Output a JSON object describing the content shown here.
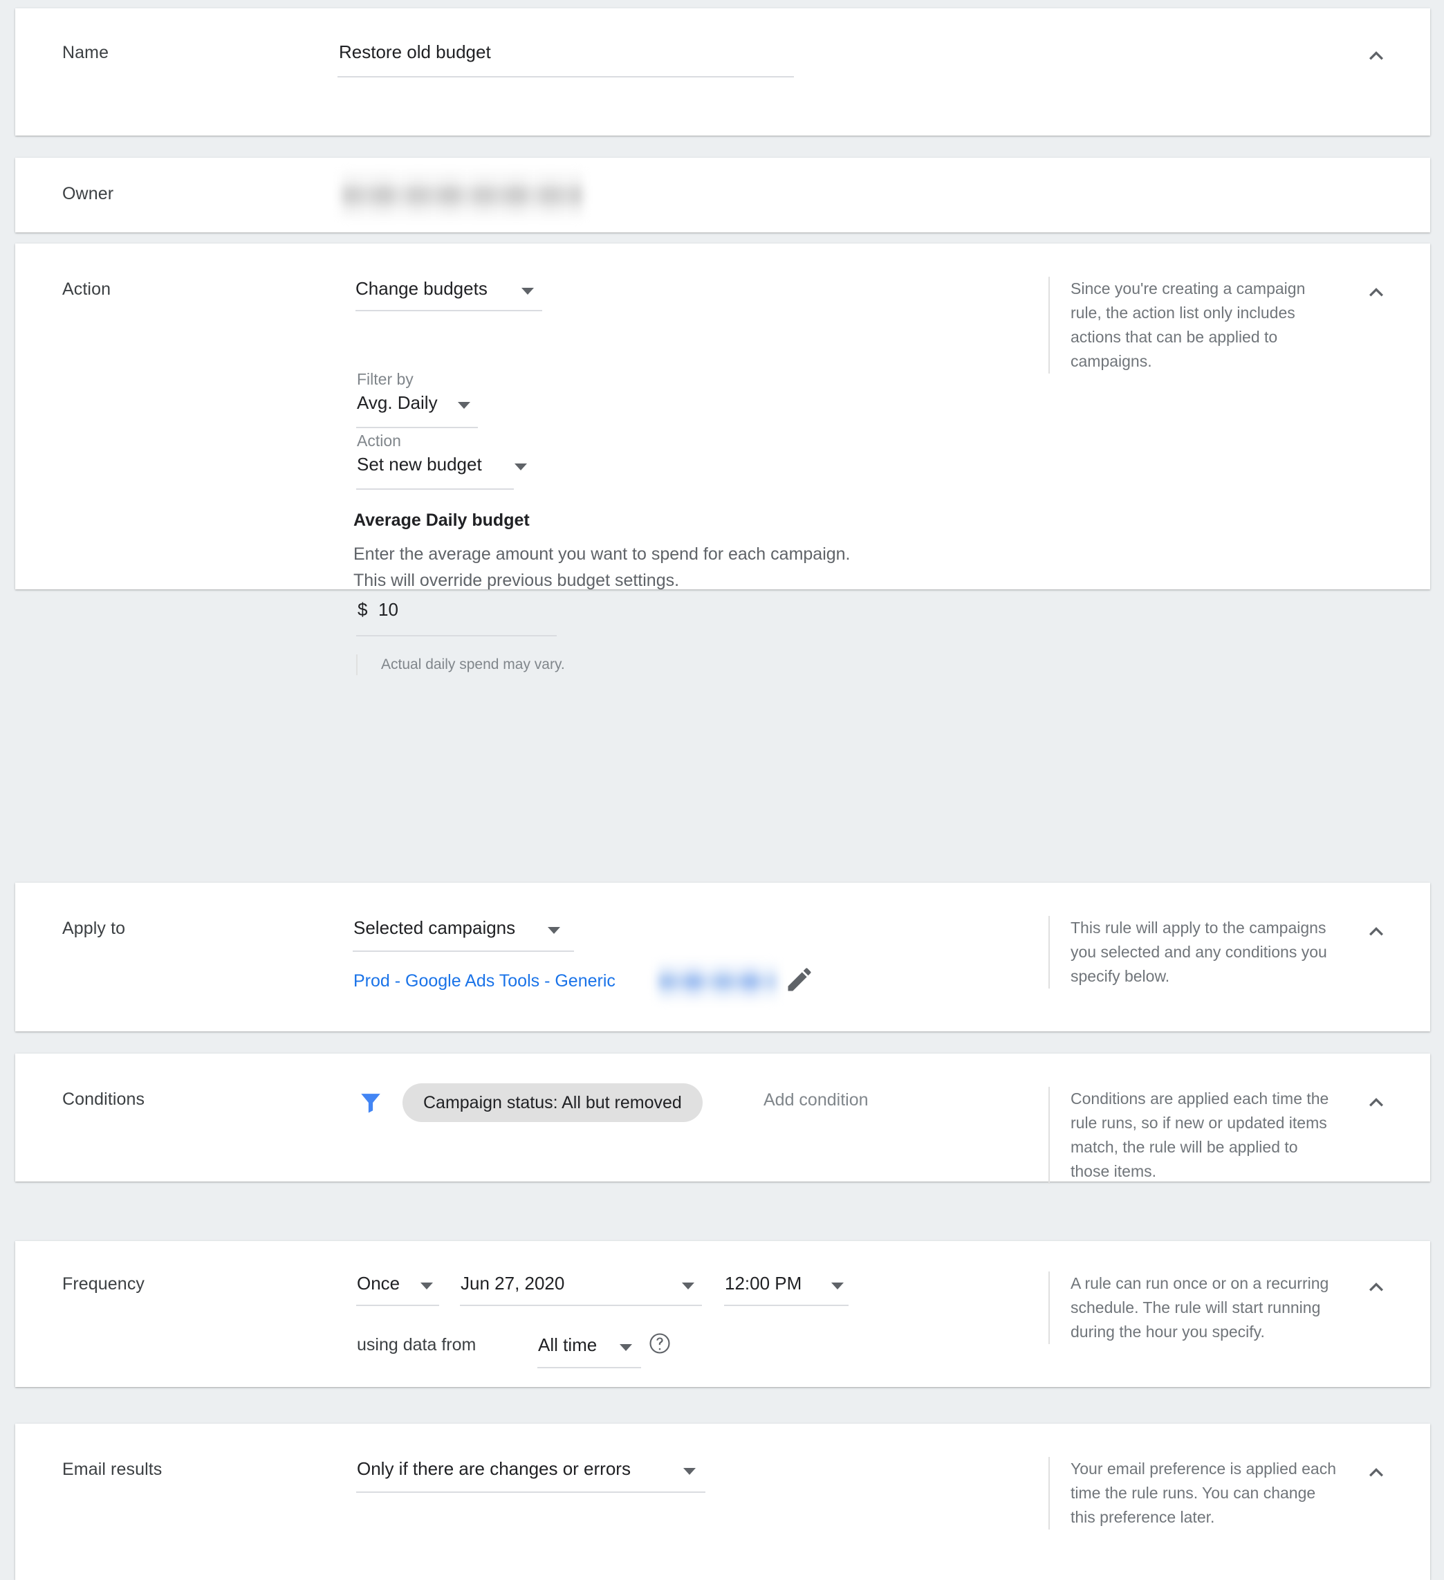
{
  "theme": {
    "page_background": "#eceff1",
    "card_background": "#ffffff",
    "text_primary": "#202124",
    "text_secondary": "#5f6368",
    "text_muted": "#80868b",
    "link_blue": "#1a73e8",
    "filter_icon_blue": "#4285f4",
    "chip_background": "#e0e0e0",
    "divider": "#dadce0"
  },
  "sections": {
    "name": {
      "label": "Name",
      "value": "Restore old budget",
      "collapse_icon": "chevron-up-icon"
    },
    "owner": {
      "label": "Owner",
      "value_redacted": true,
      "collapse_icon": null
    },
    "action": {
      "label": "Action",
      "action_select": "Change budgets",
      "filter_by_label": "Filter by",
      "filter_by_select": "Avg. Daily",
      "inner_action_label": "Action",
      "inner_action_select": "Set new budget",
      "budget_heading": "Average Daily budget",
      "budget_desc_line1": "Enter the average amount you want to spend for each campaign.",
      "budget_desc_line2": "This will override previous budget settings.",
      "currency_symbol": "$",
      "budget_amount": "10",
      "footnote": "Actual daily spend may vary.",
      "help": "Since you're creating a campaign rule, the action list only includes actions that can be applied to campaigns.",
      "collapse_icon": "chevron-up-icon"
    },
    "apply_to": {
      "label": "Apply to",
      "select": "Selected campaigns",
      "campaign_link": "Prod - Google Ads Tools - Generic",
      "campaign_link_redacted": true,
      "edit_icon": "pencil-icon",
      "help": "This rule will apply to the campaigns you selected and any conditions you specify below.",
      "collapse_icon": "chevron-up-icon"
    },
    "conditions": {
      "label": "Conditions",
      "filter_icon": "filter-funnel-icon",
      "chip": "Campaign status: All but removed",
      "add_condition": "Add condition",
      "help": "Conditions are applied each time the rule runs, so if new or updated items match, the rule will be applied to those items.",
      "collapse_icon": "chevron-up-icon"
    },
    "frequency": {
      "label": "Frequency",
      "repeat_select": "Once",
      "date_select": "Jun 27, 2020",
      "time_select": "12:00 PM",
      "using_data_from_label": "using data from",
      "data_range_select": "All time",
      "help_icon": "question-mark-circle-icon",
      "help": "A rule can run once or on a recurring schedule. The rule will start running during the hour you specify.",
      "collapse_icon": "chevron-up-icon"
    },
    "email_results": {
      "label": "Email results",
      "select": "Only if there are changes or errors",
      "help": "Your email preference is applied each time the rule runs. You can change this preference later.",
      "collapse_icon": "chevron-up-icon"
    }
  }
}
